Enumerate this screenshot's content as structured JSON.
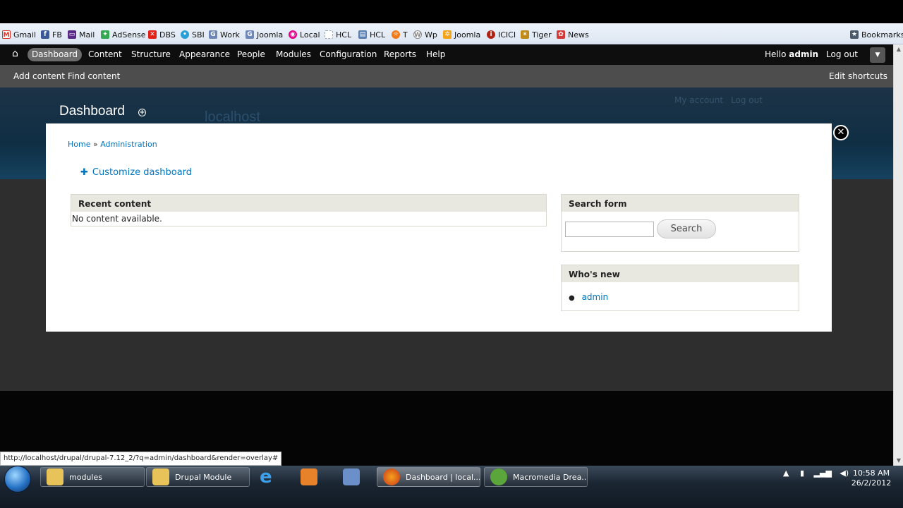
{
  "bookmarks": {
    "items": [
      {
        "label": "Gmail",
        "icon": "gmail-icon",
        "color": "#d93025"
      },
      {
        "label": "FB",
        "icon": "facebook-icon",
        "color": "#3b5998"
      },
      {
        "label": "Mail",
        "icon": "yahoo-mail-icon",
        "color": "#5b2a86"
      },
      {
        "label": "AdSense",
        "icon": "adsense-icon",
        "color": "#34a853"
      },
      {
        "label": "DBS",
        "icon": "dbs-icon",
        "color": "#e32119"
      },
      {
        "label": "SBI",
        "icon": "sbi-icon",
        "color": "#2a9fd6"
      },
      {
        "label": "Work",
        "icon": "google-icon",
        "color": "#6d87b8"
      },
      {
        "label": "Joomla",
        "icon": "google-icon",
        "color": "#6d87b8"
      },
      {
        "label": "Local",
        "icon": "local-icon",
        "color": "#e5008a"
      },
      {
        "label": "HCL",
        "icon": "hcl-icon",
        "color": "#9aa7b8"
      },
      {
        "label": "HCL",
        "icon": "hcl-doc-icon",
        "color": "#5a7fb0"
      },
      {
        "label": "T",
        "icon": "t-icon",
        "color": "#f07a1a"
      },
      {
        "label": "Wp",
        "icon": "wordpress-icon",
        "color": "#888888"
      },
      {
        "label": "Joomla",
        "icon": "joomla-icon",
        "color": "#f4a41a"
      },
      {
        "label": "ICICI",
        "icon": "icici-icon",
        "color": "#b02418"
      },
      {
        "label": "Tiger",
        "icon": "tiger-icon",
        "color": "#c08a18"
      },
      {
        "label": "News",
        "icon": "news-icon",
        "color": "#d33a3a"
      }
    ],
    "right_label": "Bookmarks"
  },
  "toolbar": {
    "home_icon": "home-icon",
    "active_item": "Dashboard",
    "items": [
      "Content",
      "Structure",
      "Appearance",
      "People",
      "Modules",
      "Configuration",
      "Reports",
      "Help"
    ],
    "hello": "Hello",
    "user": "admin",
    "logout": "Log out"
  },
  "shortcuts": {
    "add_content": "Add content",
    "find_content": "Find content",
    "edit_shortcuts": "Edit shortcuts"
  },
  "header": {
    "page_title": "Dashboard",
    "site_name": "localhost",
    "my_account": "My account",
    "log_out": "Log out"
  },
  "overlay": {
    "breadcrumb": {
      "home": "Home",
      "sep": "»",
      "admin": "Administration"
    },
    "customize": "Customize dashboard",
    "recent_content": {
      "title": "Recent content",
      "empty": "No content available."
    },
    "search_form": {
      "title": "Search form",
      "input_value": "",
      "button": "Search"
    },
    "whos_new": {
      "title": "Who's new",
      "users": [
        "admin"
      ]
    }
  },
  "status_url": "http://localhost/drupal/drupal-7.12_2/?q=admin/dashboard&render=overlay#",
  "taskbar": {
    "items": [
      {
        "label": "modules",
        "icon": "folder-icon"
      },
      {
        "label": "Drupal Module",
        "icon": "folder-icon"
      },
      {
        "label": "",
        "icon": "internet-explorer-icon"
      },
      {
        "label": "",
        "icon": "media-player-icon"
      },
      {
        "label": "",
        "icon": "tool-icon"
      },
      {
        "label": "Dashboard | local...",
        "icon": "firefox-icon"
      },
      {
        "label": "Macromedia Drea...",
        "icon": "dreamweaver-icon"
      }
    ],
    "time": "10:58 AM",
    "date": "26/2/2012"
  }
}
